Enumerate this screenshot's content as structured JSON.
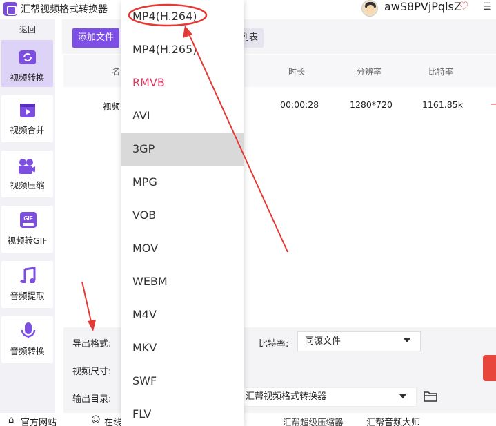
{
  "window": {
    "title": "汇帮视频格式转换器",
    "user": "awS8PVjPqlsZ"
  },
  "sidebar": {
    "back": "返回",
    "items": [
      {
        "label": "视频转换",
        "icon": "video-convert-icon"
      },
      {
        "label": "视频合并",
        "icon": "video-merge-icon"
      },
      {
        "label": "视频压缩",
        "icon": "video-compress-icon"
      },
      {
        "label": "视频转GIF",
        "icon": "gif-icon"
      },
      {
        "label": "音频提取",
        "icon": "music-icon"
      },
      {
        "label": "音频转换",
        "icon": "microphone-icon"
      }
    ]
  },
  "toolbar": {
    "add_file": "添加文件",
    "list_partial": "列表"
  },
  "table": {
    "headers": {
      "name_partial": "名",
      "duration": "时长",
      "resolution": "分辨率",
      "bitrate": "比特率"
    },
    "rows": [
      {
        "name_partial": "视频",
        "duration": "00:00:28",
        "resolution": "1280*720",
        "bitrate": "1161.85k"
      }
    ]
  },
  "settings": {
    "format_label": "导出格式:",
    "size_label": "视频尺寸:",
    "output_label": "输出目录:",
    "bitrate_label": "比特率:",
    "bitrate_value": "同源文件",
    "output_value": "汇帮视频格式转换器"
  },
  "footer": {
    "official_site": "官方网站",
    "online_partial": "在线",
    "compressor": "汇帮超级压缩器",
    "audio_master": "汇帮音频大师"
  },
  "dropdown": {
    "options": [
      "MP4(H.264)",
      "MP4(H.265)",
      "RMVB",
      "AVI",
      "3GP",
      "MPG",
      "VOB",
      "MOV",
      "WEBM",
      "M4V",
      "MKV",
      "SWF",
      "FLV"
    ],
    "highlighted": "3GP",
    "circled": "MP4(H.264)"
  },
  "colors": {
    "accent": "#7e4fe6",
    "annotation_red": "#e53935",
    "rmvb_text": "#d93a61"
  }
}
